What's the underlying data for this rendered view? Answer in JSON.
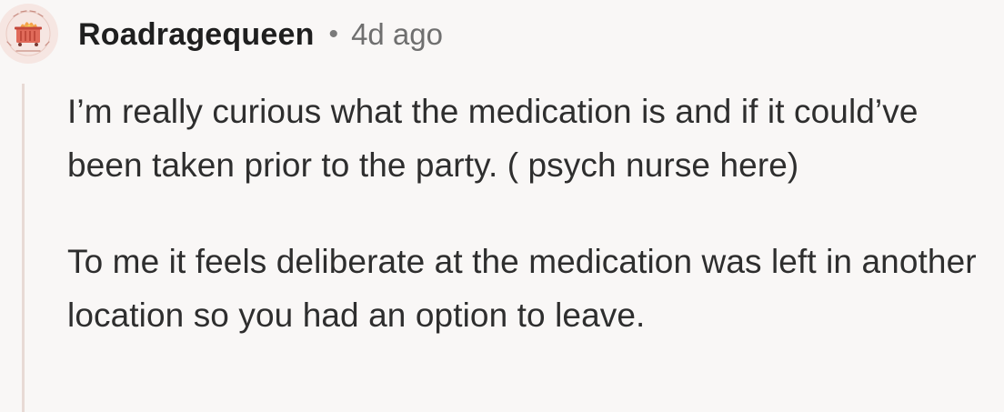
{
  "comment": {
    "author": "Roadragequeen",
    "separator": "•",
    "time": "4d ago",
    "paragraphs": [
      "I’m really curious what the medication is and if it could’ve been taken prior to the party. ( psych nurse here)",
      "To me it feels deliberate at the medication was left in another location so you had an option to leave."
    ]
  },
  "avatar": {
    "icon": "dumpster-fire-badge-icon",
    "background": "#f6e6e2",
    "accent": "#e07a5f"
  },
  "colors": {
    "background": "#f9f7f6",
    "thread_line": "#e8dad5",
    "text": "#2e2e2e",
    "meta": "#6f6f6f"
  }
}
